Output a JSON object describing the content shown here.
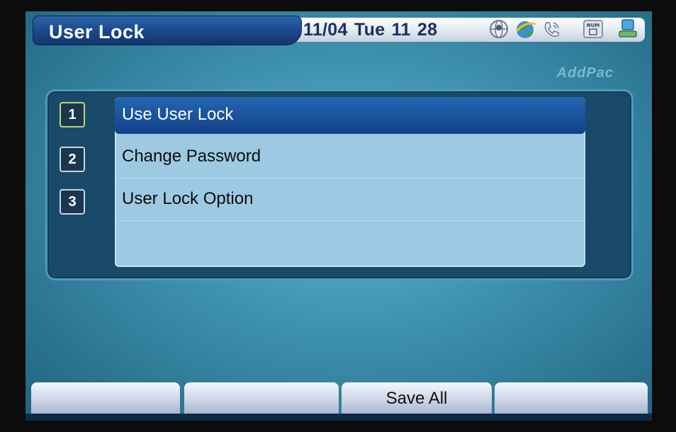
{
  "header": {
    "title": "User Lock",
    "datetime": "11/04 Tue 11 28",
    "status_icons": [
      "globe-icon",
      "earth-icon",
      "phone-icon",
      "num-lock-icon",
      "computer-icon"
    ],
    "num_label": "NUM"
  },
  "brand": "AddPac",
  "menu": {
    "items": [
      {
        "number": "1",
        "label": "Use User Lock",
        "selected": true
      },
      {
        "number": "2",
        "label": "Change Password",
        "selected": false
      },
      {
        "number": "3",
        "label": "User Lock Option",
        "selected": false
      }
    ]
  },
  "softkeys": [
    "",
    "",
    "Save All",
    ""
  ],
  "colors": {
    "title_bar": "#1b478b",
    "selected_row": "#1a54a0",
    "list_background": "#9ec9e2",
    "screen_background": "#3d90ad"
  }
}
